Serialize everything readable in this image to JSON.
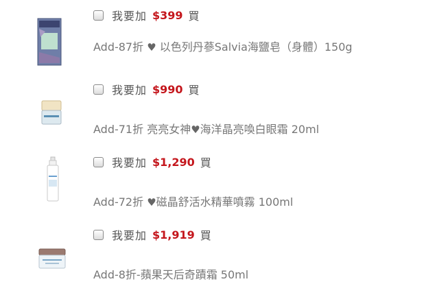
{
  "items": [
    {
      "add_prefix": "我要加",
      "price": "$399",
      "add_suffix": "買",
      "name_pre": "Add-87折 ",
      "heart": "♥",
      "name_post": " 以色列丹蔘Salvia海鹽皂（身體）150g"
    },
    {
      "add_prefix": "我要加",
      "price": "$990",
      "add_suffix": "買",
      "name_pre": "Add-71折 亮亮女神",
      "heart": "♥",
      "name_post": "海洋晶亮喚白眼霜 20ml"
    },
    {
      "add_prefix": "我要加",
      "price": "$1,290",
      "add_suffix": "買",
      "name_pre": "Add-72折 ",
      "heart": "♥",
      "name_post": "磁晶舒活水精華噴霧 100ml"
    },
    {
      "add_prefix": "我要加",
      "price": "$1,919",
      "add_suffix": "買",
      "name_pre": "Add-8折-蘋果天后奇蹟霜 50ml",
      "heart": "",
      "name_post": ""
    }
  ]
}
